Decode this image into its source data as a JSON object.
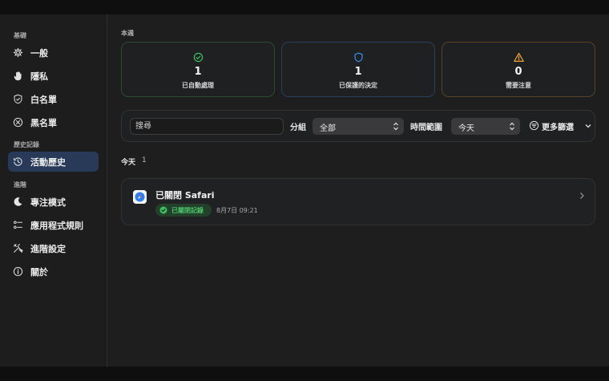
{
  "sidebar": {
    "sections": [
      {
        "label": "基礎",
        "items": [
          {
            "label": "一般",
            "icon": "gear-icon"
          },
          {
            "label": "隱私",
            "icon": "hand-icon"
          },
          {
            "label": "白名單",
            "icon": "shield-check-icon"
          },
          {
            "label": "黑名單",
            "icon": "x-circle-icon"
          }
        ]
      },
      {
        "label": "歷史記錄",
        "items": [
          {
            "label": "活動歷史",
            "icon": "history-icon",
            "active": true
          }
        ]
      },
      {
        "label": "進階",
        "items": [
          {
            "label": "專注模式",
            "icon": "moon-icon"
          },
          {
            "label": "應用程式規則",
            "icon": "rules-list-icon"
          },
          {
            "label": "進階設定",
            "icon": "tools-icon"
          },
          {
            "label": "關於",
            "icon": "info-icon"
          }
        ]
      }
    ]
  },
  "main": {
    "week_label": "本週",
    "stats": [
      {
        "value": "1",
        "label": "已自動處理",
        "icon": "check-circle-icon",
        "color": "#3fbf5f"
      },
      {
        "value": "1",
        "label": "已保護的決定",
        "icon": "shield-icon",
        "color": "#3d8ef0"
      },
      {
        "value": "0",
        "label": "需要注意",
        "icon": "warning-triangle-icon",
        "color": "#f2a33a"
      }
    ],
    "filters": {
      "search_placeholder": "搜尋",
      "group_label": "分組",
      "group_value": "全部",
      "time_label": "時間範圍",
      "time_value": "今天",
      "more_label": "更多篩選"
    },
    "day_group": {
      "label": "今天",
      "count": "1"
    },
    "events": [
      {
        "title": "已關閉 Safari",
        "badge": "已關閉記錄",
        "time": "8月7日 09:21",
        "app_icon": "safari-icon"
      }
    ]
  },
  "colors": {
    "accent_blue": "#283a57",
    "success_green": "#4fc26b",
    "warning_orange": "#f2a33a"
  }
}
